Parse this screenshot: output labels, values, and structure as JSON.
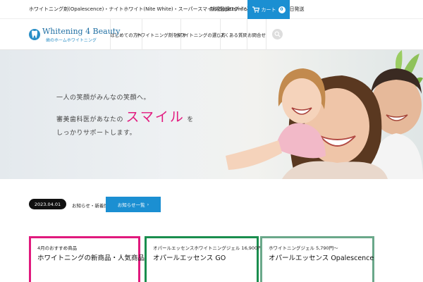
{
  "topbar": {
    "message": "ホワイトニング剤(Opalescence)・ナイトホワイト(Nite White)・スーパースマイル(Supersmile)などを14時まで当日発送",
    "links": [
      "新規登録",
      "ログイン"
    ],
    "cart_label": "カート",
    "cart_count": "0"
  },
  "header": {
    "logo_name": "Whitening 4 Beauty",
    "logo_sub": "歯のホームホワイトニング",
    "nav": [
      "はじめての方へ",
      "ホワイトニング剤を探す",
      "ホワイトニングの選び方",
      "よくある質問",
      "お問合せ"
    ]
  },
  "hero": {
    "line1": "一人の笑顔がみんなの笑顔へ。",
    "line2_pre": "審美歯科医があなたの",
    "line2_big": "スマイル",
    "line2_post": "を",
    "line3": "しっかりサポートします。"
  },
  "news": {
    "date": "2023.04.01",
    "text": "お知らせ・新着情報一覧",
    "button": "お知らせ一覧"
  },
  "cards": [
    {
      "top": "4月のおすすめ商品",
      "title": "ホワイトニングの新商品・人気商品をご紹介します",
      "color": "#e0197d"
    },
    {
      "top": "オパールエッセンスホワイトニングジェル 16,900円",
      "title": "オパールエッセンス GO",
      "color": "#1a8e4e"
    },
    {
      "top": "ホワイトニングジェル 5,790円〜",
      "title": "オパールエッセンス Opalescence",
      "color": "#6aa88a"
    }
  ]
}
